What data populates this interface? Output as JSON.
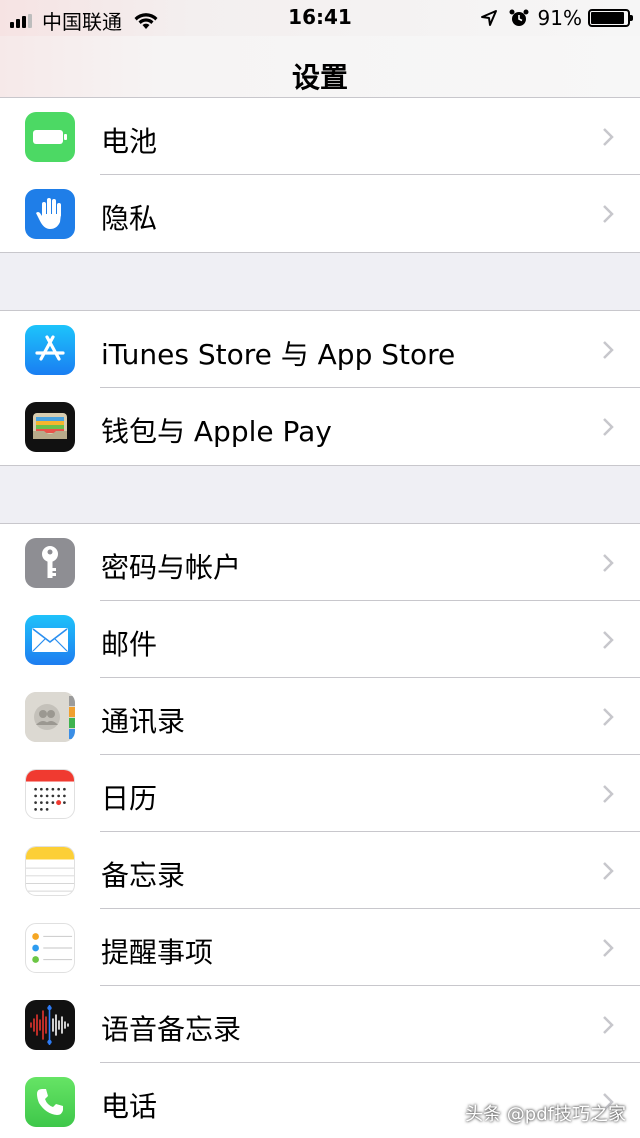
{
  "status_bar": {
    "carrier": "中国联通",
    "time": "16:41",
    "battery_percent": "91%",
    "battery_level": 0.91
  },
  "nav": {
    "title": "设置"
  },
  "groups": [
    {
      "items": [
        {
          "label": "电池",
          "icon": "battery-icon",
          "color": "#4cd964"
        },
        {
          "label": "隐私",
          "icon": "privacy-hand-icon",
          "color": "#1f7ee8"
        }
      ]
    },
    {
      "items": [
        {
          "label": "iTunes Store 与 App Store",
          "icon": "app-store-icon",
          "color": "#1a9bf5"
        },
        {
          "label": "钱包与 Apple Pay",
          "icon": "wallet-icon",
          "color": "#000000"
        }
      ]
    },
    {
      "items": [
        {
          "label": "密码与帐户",
          "icon": "key-icon",
          "color": "#8e8e93"
        },
        {
          "label": "邮件",
          "icon": "mail-icon",
          "color": "#2196f3"
        },
        {
          "label": "通讯录",
          "icon": "contacts-icon",
          "color": "#d9d6cf"
        },
        {
          "label": "日历",
          "icon": "calendar-icon",
          "color": "#ffffff"
        },
        {
          "label": "备忘录",
          "icon": "notes-icon",
          "color": "#ffffff"
        },
        {
          "label": "提醒事项",
          "icon": "reminders-icon",
          "color": "#ffffff"
        },
        {
          "label": "语音备忘录",
          "icon": "voice-memos-icon",
          "color": "#000000"
        },
        {
          "label": "电话",
          "icon": "phone-icon",
          "color": "#4cd964"
        }
      ]
    }
  ],
  "watermark": "头条 @pdf技巧之家"
}
